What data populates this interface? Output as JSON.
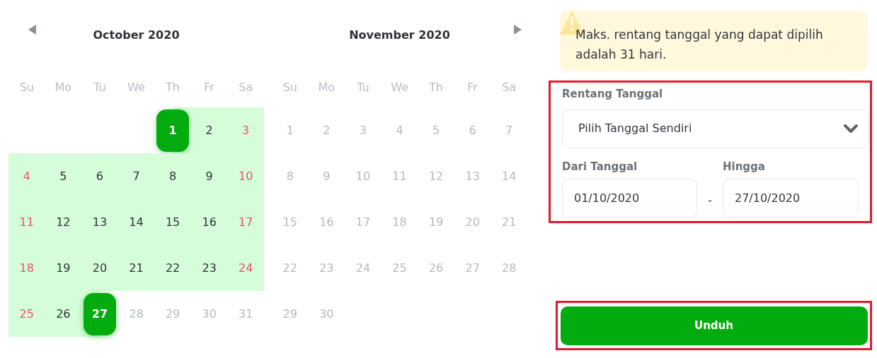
{
  "months": [
    {
      "title": "October 2020",
      "prev_arrow": true,
      "weekdays": [
        "Su",
        "Mo",
        "Tu",
        "We",
        "Th",
        "Fr",
        "Sa"
      ],
      "weeks": [
        [
          {
            "kind": "blank"
          },
          {
            "kind": "blank"
          },
          {
            "kind": "blank"
          },
          {
            "kind": "blank"
          },
          {
            "text": "1",
            "kind": "start"
          },
          {
            "text": "2",
            "kind": "range"
          },
          {
            "text": "3",
            "kind": "range_weekend"
          }
        ],
        [
          {
            "text": "4",
            "kind": "range_weekend"
          },
          {
            "text": "5",
            "kind": "range"
          },
          {
            "text": "6",
            "kind": "range"
          },
          {
            "text": "7",
            "kind": "range"
          },
          {
            "text": "8",
            "kind": "range"
          },
          {
            "text": "9",
            "kind": "range"
          },
          {
            "text": "10",
            "kind": "range_weekend"
          }
        ],
        [
          {
            "text": "11",
            "kind": "range_weekend"
          },
          {
            "text": "12",
            "kind": "range"
          },
          {
            "text": "13",
            "kind": "range"
          },
          {
            "text": "14",
            "kind": "range"
          },
          {
            "text": "15",
            "kind": "range"
          },
          {
            "text": "16",
            "kind": "range"
          },
          {
            "text": "17",
            "kind": "range_weekend"
          }
        ],
        [
          {
            "text": "18",
            "kind": "range_weekend"
          },
          {
            "text": "19",
            "kind": "range"
          },
          {
            "text": "20",
            "kind": "range"
          },
          {
            "text": "21",
            "kind": "range"
          },
          {
            "text": "22",
            "kind": "range"
          },
          {
            "text": "23",
            "kind": "range"
          },
          {
            "text": "24",
            "kind": "range_weekend"
          }
        ],
        [
          {
            "text": "25",
            "kind": "range_weekend"
          },
          {
            "text": "26",
            "kind": "range"
          },
          {
            "text": "27",
            "kind": "end"
          },
          {
            "text": "28",
            "kind": "disabled"
          },
          {
            "text": "29",
            "kind": "disabled"
          },
          {
            "text": "30",
            "kind": "disabled"
          },
          {
            "text": "31",
            "kind": "disabled"
          }
        ]
      ]
    },
    {
      "title": "November 2020",
      "next_arrow": true,
      "weekdays": [
        "Su",
        "Mo",
        "Tu",
        "We",
        "Th",
        "Fr",
        "Sa"
      ],
      "weeks": [
        [
          {
            "text": "1",
            "kind": "disabled"
          },
          {
            "text": "2",
            "kind": "disabled"
          },
          {
            "text": "3",
            "kind": "disabled"
          },
          {
            "text": "4",
            "kind": "disabled"
          },
          {
            "text": "5",
            "kind": "disabled"
          },
          {
            "text": "6",
            "kind": "disabled"
          },
          {
            "text": "7",
            "kind": "disabled"
          }
        ],
        [
          {
            "text": "8",
            "kind": "disabled"
          },
          {
            "text": "9",
            "kind": "disabled"
          },
          {
            "text": "10",
            "kind": "disabled"
          },
          {
            "text": "11",
            "kind": "disabled"
          },
          {
            "text": "12",
            "kind": "disabled"
          },
          {
            "text": "13",
            "kind": "disabled"
          },
          {
            "text": "14",
            "kind": "disabled"
          }
        ],
        [
          {
            "text": "15",
            "kind": "disabled"
          },
          {
            "text": "16",
            "kind": "disabled"
          },
          {
            "text": "17",
            "kind": "disabled"
          },
          {
            "text": "18",
            "kind": "disabled"
          },
          {
            "text": "19",
            "kind": "disabled"
          },
          {
            "text": "20",
            "kind": "disabled"
          },
          {
            "text": "21",
            "kind": "disabled"
          }
        ],
        [
          {
            "text": "22",
            "kind": "disabled"
          },
          {
            "text": "23",
            "kind": "disabled"
          },
          {
            "text": "24",
            "kind": "disabled"
          },
          {
            "text": "25",
            "kind": "disabled"
          },
          {
            "text": "26",
            "kind": "disabled"
          },
          {
            "text": "27",
            "kind": "disabled"
          },
          {
            "text": "28",
            "kind": "disabled"
          }
        ],
        [
          {
            "text": "29",
            "kind": "disabled"
          },
          {
            "text": "30",
            "kind": "disabled"
          },
          {
            "kind": "blank"
          },
          {
            "kind": "blank"
          },
          {
            "kind": "blank"
          },
          {
            "kind": "blank"
          },
          {
            "kind": "blank"
          }
        ]
      ]
    }
  ],
  "notice": {
    "text": "Maks. rentang tanggal yang dapat dipilih adalah 31 hari."
  },
  "form": {
    "highlighted": true,
    "range_label": "Rentang Tanggal",
    "range_value": "Pilih Tanggal Sendiri",
    "from_label": "Dari Tanggal",
    "from_value": "01/10/2020",
    "separator": "-",
    "to_label": "Hingga",
    "to_value": "27/10/2020"
  },
  "download": {
    "label": "Unduh",
    "highlighted": true
  }
}
